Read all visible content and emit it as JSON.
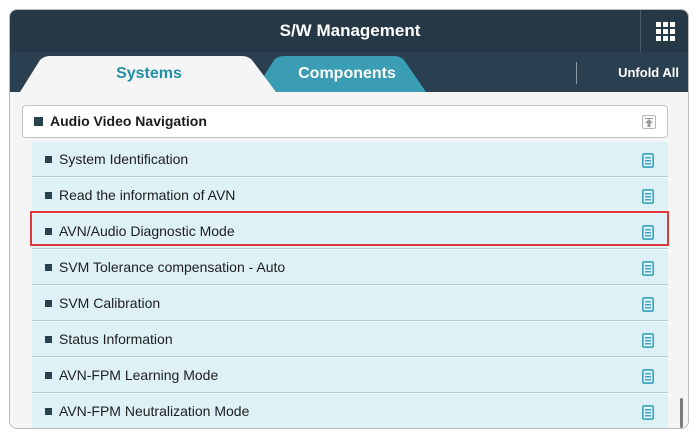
{
  "window": {
    "title": "S/W Management",
    "menu_icon": "grid-icon"
  },
  "tabs": [
    {
      "label": "Systems",
      "active": true
    },
    {
      "label": "Components",
      "active": false
    }
  ],
  "unfold_all_label": "Unfold All",
  "group": {
    "title": "Audio Video Navigation",
    "collapse_icon": "collapse-up-icon"
  },
  "items": [
    {
      "label": "System Identification",
      "icon": "document-icon"
    },
    {
      "label": "Read the information of AVN",
      "icon": "document-icon"
    },
    {
      "label": "AVN/Audio Diagnostic Mode",
      "icon": "document-icon",
      "highlighted": true
    },
    {
      "label": "SVM Tolerance compensation - Auto",
      "icon": "document-icon"
    },
    {
      "label": "SVM Calibration",
      "icon": "document-icon"
    },
    {
      "label": "Status Information",
      "icon": "document-icon"
    },
    {
      "label": "AVN-FPM Learning Mode",
      "icon": "document-icon"
    },
    {
      "label": "AVN-FPM Neutralization Mode",
      "icon": "document-icon"
    }
  ],
  "colors": {
    "titlebar": "#263845",
    "tab_active_text": "#2090a4",
    "tab_inactive_bg": "#3a9db3",
    "item_bg": "#ddf1f7",
    "highlight_border": "#e0393b",
    "doc_icon": "#3aa5bd"
  }
}
